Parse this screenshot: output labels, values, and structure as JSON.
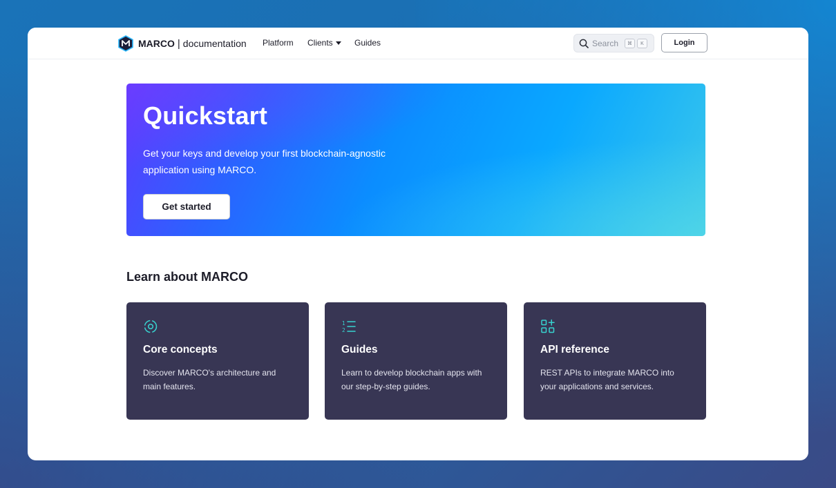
{
  "header": {
    "brand_name": "MARCO",
    "brand_sep": "|",
    "brand_doc": "documentation",
    "nav": [
      {
        "label": "Platform"
      },
      {
        "label": "Clients"
      },
      {
        "label": "Guides"
      }
    ],
    "search": {
      "placeholder": "Search",
      "shortcut_keys": [
        "⌘",
        "K"
      ]
    },
    "login_label": "Login"
  },
  "hero": {
    "title": "Quickstart",
    "description": "Get your keys and develop your first blockchain-agnostic application using MARCO.",
    "button_label": "Get started"
  },
  "learn": {
    "title": "Learn about MARCO",
    "cards": [
      {
        "icon": "orbit-icon",
        "title": "Core concepts",
        "description": "Discover MARCO's architecture and main features."
      },
      {
        "icon": "numbered-list-icon",
        "title": "Guides",
        "description": "Learn to develop blockchain apps with our step-by-step guides."
      },
      {
        "icon": "grid-add-icon",
        "title": "API reference",
        "description": "REST APIs to integrate MARCO into your applications and services."
      }
    ]
  },
  "colors": {
    "card_bg": "#383654",
    "icon_accent": "#37d4d0",
    "hero_start": "#5b3cff",
    "hero_end": "#3cc8ea"
  }
}
